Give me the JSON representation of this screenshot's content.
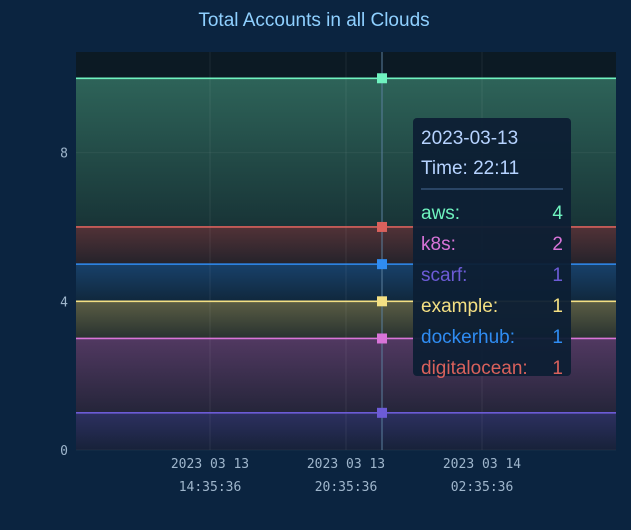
{
  "chart_data": {
    "type": "area",
    "title": "Total Accounts in all Clouds",
    "xlabel": "",
    "ylabel": "",
    "ylim": [
      0,
      10
    ],
    "yticks": [
      0,
      4,
      8
    ],
    "xticks": [
      {
        "date": "2023 03 13",
        "time": "14:35:36"
      },
      {
        "date": "2023 03 13",
        "time": "20:35:36"
      },
      {
        "date": "2023 03 14",
        "time": "02:35:36"
      }
    ],
    "stacked": true,
    "grid": true,
    "legend": "none",
    "series": [
      {
        "name": "digitalocean",
        "value": 1,
        "color": "#d9615c"
      },
      {
        "name": "dockerhub",
        "value": 1,
        "color": "#2f8cf2"
      },
      {
        "name": "example",
        "value": 1,
        "color": "#f4e083"
      },
      {
        "name": "scarf",
        "value": 1,
        "color": "#6c5bd6"
      },
      {
        "name": "k8s",
        "value": 2,
        "color": "#d874d8"
      },
      {
        "name": "aws",
        "value": 4,
        "color": "#6ff2bf"
      }
    ]
  },
  "tooltip": {
    "date": "2023-03-13",
    "time": "Time: 22:11",
    "rows": [
      {
        "label": "aws:",
        "value": "4",
        "color": "#6ff2bf"
      },
      {
        "label": "k8s:",
        "value": "2",
        "color": "#d874d8"
      },
      {
        "label": "scarf:",
        "value": "1",
        "color": "#6c5bd6"
      },
      {
        "label": "example:",
        "value": "1",
        "color": "#f4e083"
      },
      {
        "label": "dockerhub:",
        "value": "1",
        "color": "#2f8cf2"
      },
      {
        "label": "digitalocean:",
        "value": "1",
        "color": "#d9615c"
      }
    ]
  },
  "colors": {
    "background": "#0b2440",
    "plot_background": "#0c1a24",
    "tick_label": "#9fb6cc",
    "title": "#8fd0ff"
  }
}
